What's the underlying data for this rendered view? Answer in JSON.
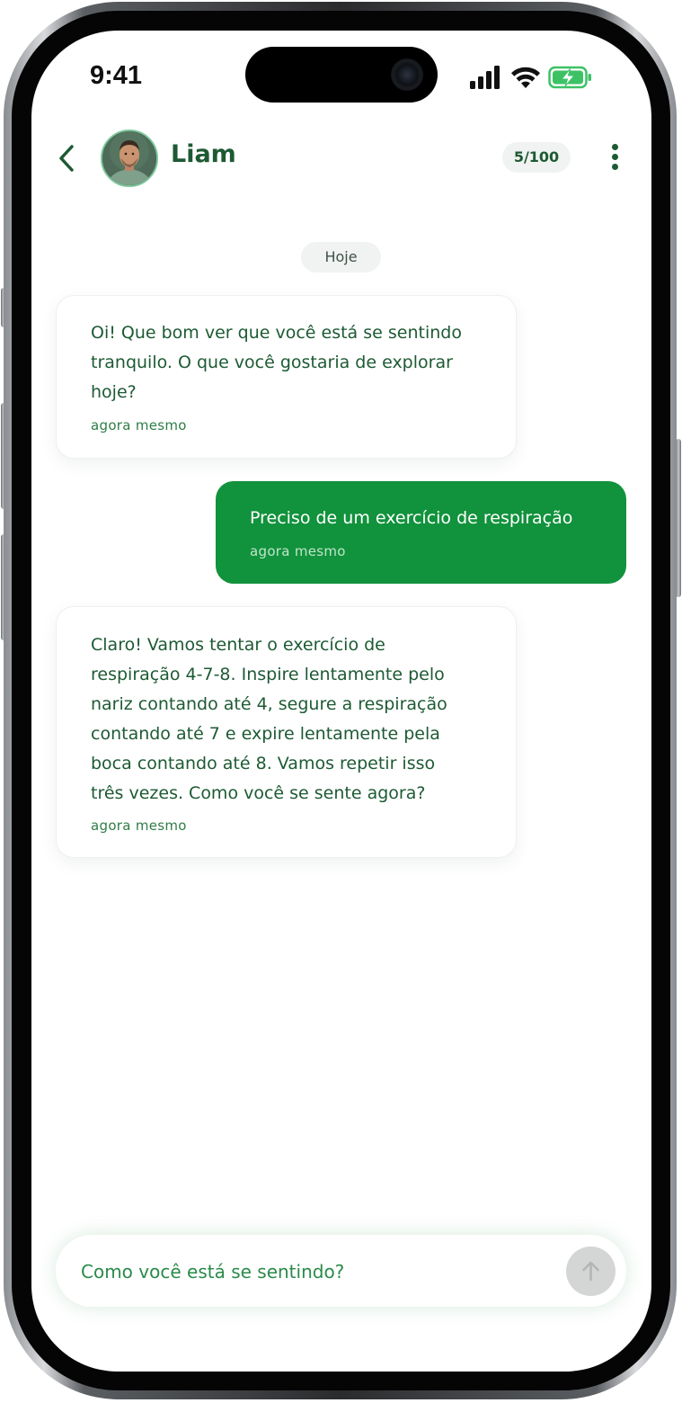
{
  "status_bar": {
    "time": "9:41",
    "icons": [
      "signal-icon",
      "wifi-icon",
      "battery-charging-icon"
    ]
  },
  "header": {
    "contact_name": "Liam",
    "message_counter": "5/100"
  },
  "chat": {
    "date_label": "Hoje",
    "messages": [
      {
        "from": "bot",
        "text": "Oi! Que bom ver que você está se sentindo\ntranquilo. O que você gostaria de explorar\nhoje?",
        "time": "agora mesmo"
      },
      {
        "from": "user",
        "text": "Preciso de um exercício de respiração",
        "time": "agora mesmo"
      },
      {
        "from": "bot",
        "text": "Claro! Vamos tentar o exercício de\nrespiração 4-7-8. Inspire lentamente pelo\nnariz contando até 4, segure a respiração\ncontando até 7 e expire lentamente pela\nboca contando até 8. Vamos repetir isso\ntrês vezes. Como você se sente agora?",
        "time": "agora mesmo"
      }
    ]
  },
  "composer": {
    "placeholder": "Como você está se sentindo?",
    "value": ""
  },
  "colors": {
    "brand_green": "#11923c",
    "text_green": "#1d5a33",
    "chip_bg": "#f0f3f1",
    "send_disabled": "#d4d6d5"
  }
}
